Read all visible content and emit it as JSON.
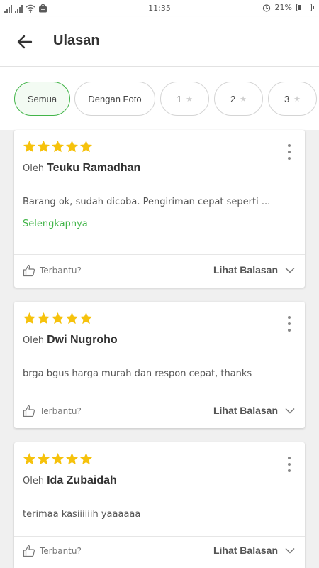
{
  "status_bar": {
    "time": "11:35",
    "battery": "21%",
    "battery_level": 0.21
  },
  "header": {
    "title": "Ulasan",
    "back_icon": "arrow-left-icon"
  },
  "filters": [
    {
      "label": "Semua",
      "active": true
    },
    {
      "label": "Dengan Foto",
      "active": false
    },
    {
      "label": "1",
      "star": true,
      "active": false
    },
    {
      "label": "2",
      "star": true,
      "active": false
    },
    {
      "label": "3",
      "star": true,
      "active": false
    }
  ],
  "colors": {
    "accent_green": "#42b549",
    "star_yellow": "#f6c20c"
  },
  "reviews": [
    {
      "rating": 5,
      "by_prefix": "Oleh",
      "author": "Teuku Ramadhan",
      "text": "Barang ok, sudah dicoba. Pengiriman cepat seperti ...",
      "read_more": "Selengkapnya",
      "helpful": "Terbantu?",
      "view_replies": "Lihat Balasan"
    },
    {
      "rating": 5,
      "by_prefix": "Oleh",
      "author": "Dwi Nugroho",
      "text": "brga bgus harga murah dan respon cepat, thanks",
      "helpful": "Terbantu?",
      "view_replies": "Lihat Balasan"
    },
    {
      "rating": 5,
      "by_prefix": "Oleh",
      "author": "Ida Zubaidah",
      "text": "terimaa kasiiiiiih yaaaaaa",
      "helpful": "Terbantu?",
      "view_replies": "Lihat Balasan"
    }
  ]
}
